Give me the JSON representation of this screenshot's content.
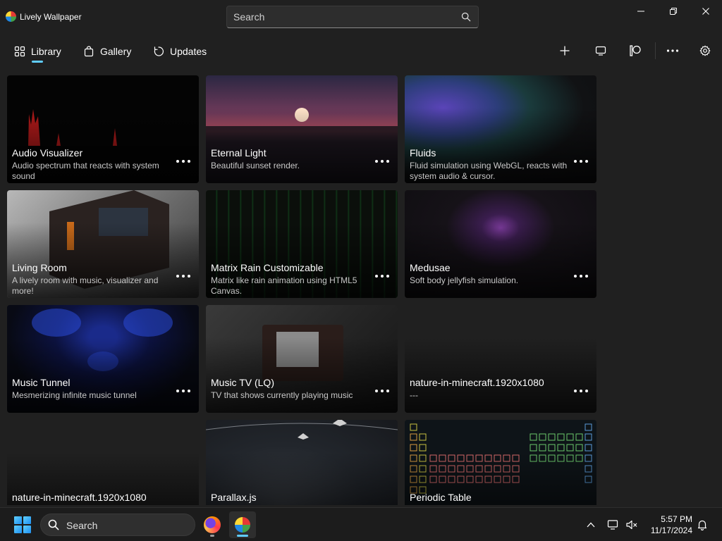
{
  "app": {
    "title": "Lively Wallpaper"
  },
  "search": {
    "placeholder": "Search",
    "value": ""
  },
  "window_controls": {
    "minimize": "minimize-icon",
    "maximize": "restore-icon",
    "close": "close-icon"
  },
  "nav": {
    "tabs": [
      {
        "label": "Library",
        "icon": "grid-icon",
        "selected": true
      },
      {
        "label": "Gallery",
        "icon": "shopping-bag-icon",
        "selected": false
      },
      {
        "label": "Updates",
        "icon": "refresh-icon",
        "selected": false
      }
    ],
    "accent_color": "#60cdff"
  },
  "toolbar": {
    "buttons": [
      "add-icon",
      "display-icon",
      "patreon-icon",
      "more-icon",
      "settings-icon"
    ]
  },
  "library": {
    "items": [
      {
        "title": "Audio Visualizer",
        "description": "Audio spectrum that reacts with system sound"
      },
      {
        "title": "Eternal Light",
        "description": "Beautiful sunset render."
      },
      {
        "title": "Fluids",
        "description": "Fluid simulation using WebGL, reacts with system audio & cursor."
      },
      {
        "title": "Living Room",
        "description": "A lively room with music, visualizer and more!"
      },
      {
        "title": "Matrix Rain Customizable",
        "description": "Matrix like rain animation using HTML5 Canvas."
      },
      {
        "title": "Medusae",
        "description": "Soft body jellyfish simulation."
      },
      {
        "title": "Music Tunnel",
        "description": "Mesmerizing infinite music tunnel"
      },
      {
        "title": "Music TV (LQ)",
        "description": "TV that shows currently playing music"
      },
      {
        "title": "nature-in-minecraft.1920x1080",
        "description": "---"
      },
      {
        "title": "nature-in-minecraft.1920x1080",
        "description": ""
      },
      {
        "title": "Parallax.js",
        "description": ""
      },
      {
        "title": "Periodic Table",
        "description": ""
      }
    ]
  },
  "taskbar": {
    "search_label": "Search",
    "apps": [
      "firefox-icon",
      "lively-wallpaper-icon"
    ],
    "tray": [
      "chevron-up-icon",
      "network-icon",
      "volume-muted-icon",
      "notification-bell-icon"
    ],
    "time": "5:57 PM",
    "date": "11/17/2024"
  }
}
